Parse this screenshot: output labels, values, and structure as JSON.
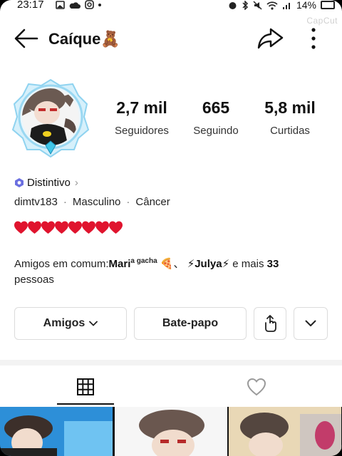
{
  "status_bar": {
    "time": "23:17",
    "battery": "14%"
  },
  "watermark": "CapCut",
  "header": {
    "title": "Caíque🧸"
  },
  "stats": [
    {
      "value": "2,7 mil",
      "label": "Seguidores"
    },
    {
      "value": "665",
      "label": "Seguindo"
    },
    {
      "value": "5,8 mil",
      "label": "Curtidas"
    }
  ],
  "badge": {
    "label": "Distintivo"
  },
  "info": {
    "username": "dimtv183",
    "gender": "Masculino",
    "sign": "Câncer",
    "separator": "·"
  },
  "hearts": "❤️❤️❤️❤️❤️❤️❤️❤️",
  "friends": {
    "prefix": "Amigos em comum:",
    "friend1": "Mari",
    "friend1_sup": "a gacha",
    "friend1_emoji": "🍕",
    "mid": "、",
    "friend2": "⚡Julya⚡",
    "more_text": " e mais ",
    "more_count": "33",
    "suffix": "pessoas"
  },
  "buttons": {
    "friends": "Amigos",
    "chat": "Bate-papo"
  },
  "colors": {
    "badge": "#6b6fe0",
    "heart": "#e0142e",
    "avatar_ring": "#8fd3f0",
    "divider": "#f3f3f3"
  }
}
